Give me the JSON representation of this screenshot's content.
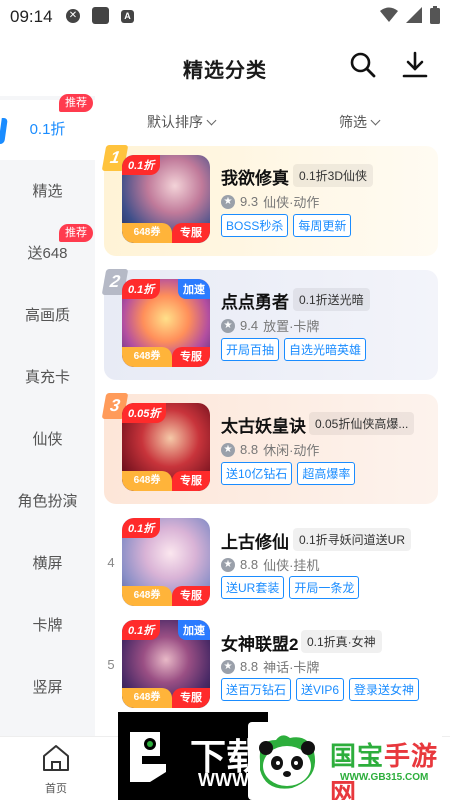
{
  "status_bar": {
    "time": "09:14",
    "icon_a": "A"
  },
  "header": {
    "title": "精选分类"
  },
  "sidebar": {
    "items": [
      {
        "label": "0.1折",
        "badge": "推荐",
        "active": true
      },
      {
        "label": "精选"
      },
      {
        "label": "送648",
        "badge": "推荐"
      },
      {
        "label": "高画质"
      },
      {
        "label": "真充卡"
      },
      {
        "label": "仙侠"
      },
      {
        "label": "角色扮演"
      },
      {
        "label": "横屏"
      },
      {
        "label": "卡牌"
      },
      {
        "label": "竖屏"
      }
    ]
  },
  "sort_bar": {
    "sort_label": "默认排序",
    "filter_label": "筛选"
  },
  "games": [
    {
      "rank": "1",
      "name": "我欲修真",
      "deal": "0.1折3D仙侠",
      "rating": "9.3",
      "genre": "仙侠·动作",
      "tags": [
        "BOSS秒杀",
        "每周更新"
      ],
      "discount": "0.1折",
      "coupon": "648券",
      "exclusive": "专服"
    },
    {
      "rank": "2",
      "name": "点点勇者",
      "deal": "0.1折送光暗",
      "rating": "9.4",
      "genre": "放置·卡牌",
      "tags": [
        "开局百抽",
        "自选光暗英雄"
      ],
      "discount": "0.1折",
      "boost": "加速",
      "coupon": "648券",
      "exclusive": "专服"
    },
    {
      "rank": "3",
      "name": "太古妖皇诀",
      "deal": "0.05折仙侠高爆...",
      "rating": "8.8",
      "genre": "休闲·动作",
      "tags": [
        "送10亿钻石",
        "超高爆率"
      ],
      "discount": "0.05折",
      "coupon": "648券",
      "exclusive": "专服"
    },
    {
      "rank": "4",
      "name": "上古修仙",
      "deal": "0.1折寻妖问道送UR",
      "rating": "8.8",
      "genre": "仙侠·挂机",
      "tags": [
        "送UR套装",
        "开局一条龙"
      ],
      "discount": "0.1折",
      "coupon": "648券",
      "exclusive": "专服"
    },
    {
      "rank": "5",
      "name": "女神联盟2",
      "deal": "0.1折真·女神",
      "rating": "8.8",
      "genre": "神话·卡牌",
      "tags": [
        "送百万钻石",
        "送VIP6",
        "登录送女神"
      ],
      "discount": "0.1折",
      "boost": "加速",
      "coupon": "648券",
      "exclusive": "专服"
    }
  ],
  "bottom_nav": {
    "home_label": "首页"
  },
  "watermarks": {
    "left_big": "下载",
    "left_www": "WWW",
    "right_name_a": "国宝",
    "right_name_b": "手游网",
    "right_url": "WWW.GB315.COM"
  },
  "colors": {
    "accent": "#1a8cff",
    "badge_red": "#ff3b4e",
    "coupon_orange": "#ffb43a"
  },
  "icons": [
    "search-icon",
    "download-icon",
    "home-icon",
    "star-icon",
    "wifi-icon",
    "signal-icon",
    "battery-icon"
  ]
}
